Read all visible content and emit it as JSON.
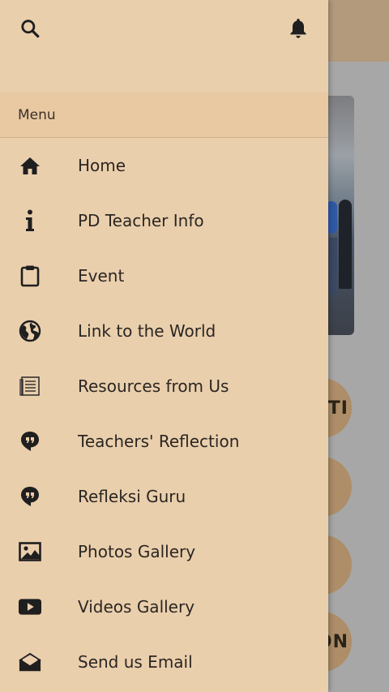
{
  "header": {
    "search_icon": "search-icon",
    "notification_icon": "bell-icon"
  },
  "menu": {
    "section_label": "Menu",
    "items": [
      {
        "label": "Home",
        "icon": "home-icon"
      },
      {
        "label": "PD Teacher Info",
        "icon": "info-icon"
      },
      {
        "label": "Event",
        "icon": "clipboard-icon"
      },
      {
        "label": "Link to the World",
        "icon": "globe-icon"
      },
      {
        "label": "Resources from Us",
        "icon": "document-icon"
      },
      {
        "label": "Teachers' Reflection",
        "icon": "quote-bubble-icon"
      },
      {
        "label": "Refleksi Guru",
        "icon": "quote-bubble-icon"
      },
      {
        "label": "Photos Gallery",
        "icon": "image-icon"
      },
      {
        "label": "Videos Gallery",
        "icon": "video-icon"
      },
      {
        "label": "Send us Email",
        "icon": "email-icon"
      }
    ]
  },
  "background": {
    "circle_1_text": "TI",
    "circle_4_text": "ON"
  },
  "colors": {
    "drawer_bg": "#eacfad",
    "menu_section_bg": "#e8c9a2",
    "text": "#2b2622",
    "overlay": "#a7a7a7"
  }
}
